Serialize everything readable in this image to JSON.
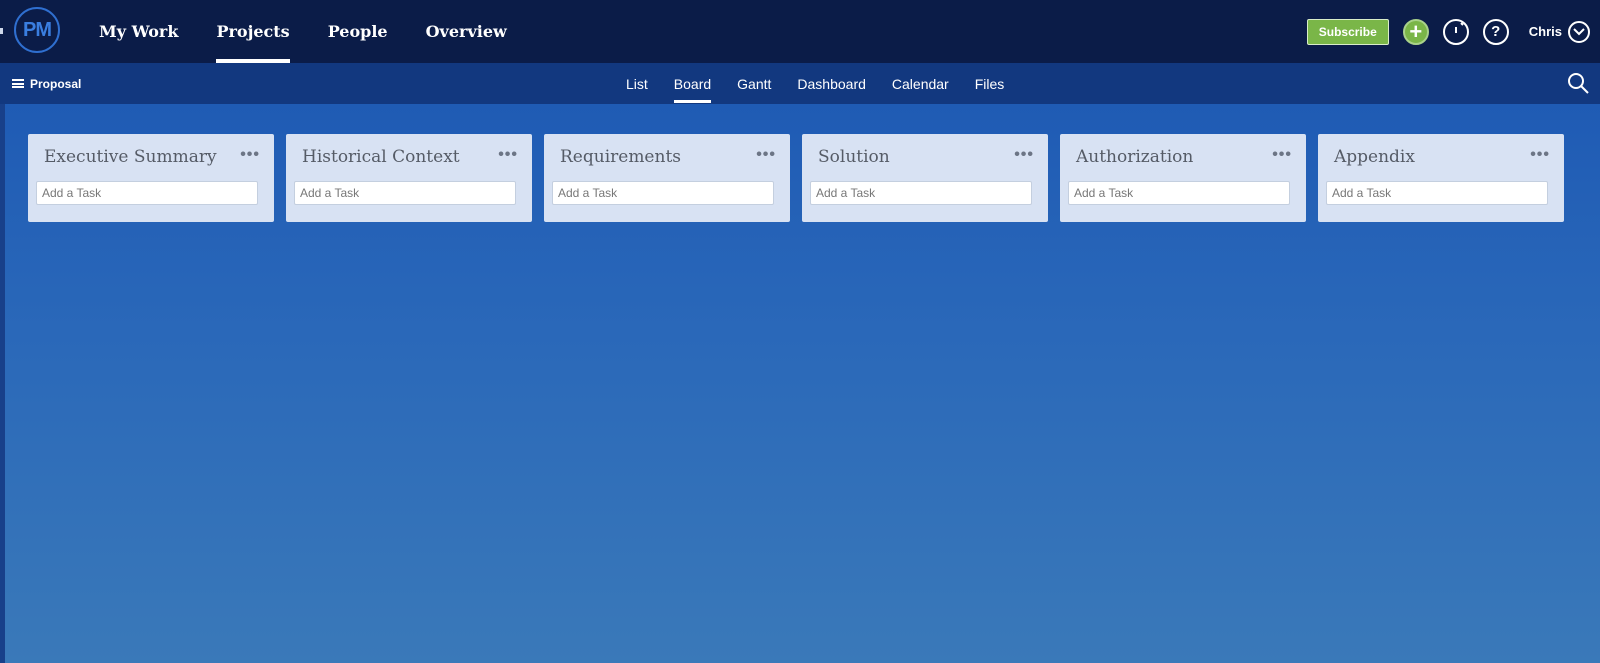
{
  "app": {
    "logo_text": "PM"
  },
  "topnav": {
    "items": [
      {
        "label": "My Work"
      },
      {
        "label": "Projects"
      },
      {
        "label": "People"
      },
      {
        "label": "Overview"
      }
    ],
    "active": "Projects"
  },
  "topright": {
    "subscribe_label": "Subscribe",
    "user_name": "Chris",
    "icons": [
      "plus-icon",
      "timer-icon",
      "help-icon",
      "chevron-down-icon"
    ]
  },
  "subnav": {
    "project_name": "Proposal",
    "tabs": [
      {
        "label": "List"
      },
      {
        "label": "Board"
      },
      {
        "label": "Gantt"
      },
      {
        "label": "Dashboard"
      },
      {
        "label": "Calendar"
      },
      {
        "label": "Files"
      }
    ],
    "active_tab": "Board"
  },
  "board": {
    "columns": [
      {
        "title": "Executive Summary",
        "add_placeholder": "Add a Task",
        "menu": "•••"
      },
      {
        "title": "Historical Context",
        "add_placeholder": "Add a Task",
        "menu": "•••"
      },
      {
        "title": "Requirements",
        "add_placeholder": "Add a Task",
        "menu": "•••"
      },
      {
        "title": "Solution",
        "add_placeholder": "Add a Task",
        "menu": "•••"
      },
      {
        "title": "Authorization",
        "add_placeholder": "Add a Task",
        "menu": "•••"
      },
      {
        "title": "Appendix",
        "add_placeholder": "Add a Task",
        "menu": "•••"
      }
    ]
  },
  "colors": {
    "topbar": "#0b1c48",
    "subbar": "#12387f",
    "accent_green": "#7ab648",
    "column_bg": "#d8e2f3"
  }
}
